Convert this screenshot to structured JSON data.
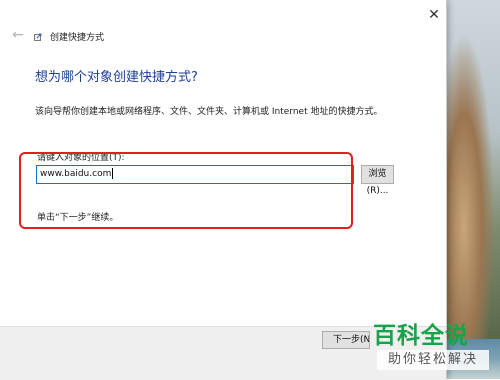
{
  "window": {
    "title": "创建快捷方式",
    "close_glyph": "✕",
    "back_glyph": "←"
  },
  "page": {
    "heading": "想为哪个对象创建快捷方式?",
    "description": "该向导帮你创建本地或网络程序、文件、文件夹、计算机或 Internet 地址的快捷方式。",
    "field_label": "请键入对象的位置(T):",
    "location_value": "www.baidu.com",
    "browse_label": "浏览(R)...",
    "hint": "单击“下一步”继续。"
  },
  "footer": {
    "next_label": "下一步(N)"
  },
  "watermark": {
    "title": "百科全说",
    "subtitle": "助你轻松解决"
  },
  "colors": {
    "heading": "#1e3f9a",
    "focus_border": "#0078d7",
    "annotation": "#e02020",
    "watermark": "#16a34a"
  }
}
